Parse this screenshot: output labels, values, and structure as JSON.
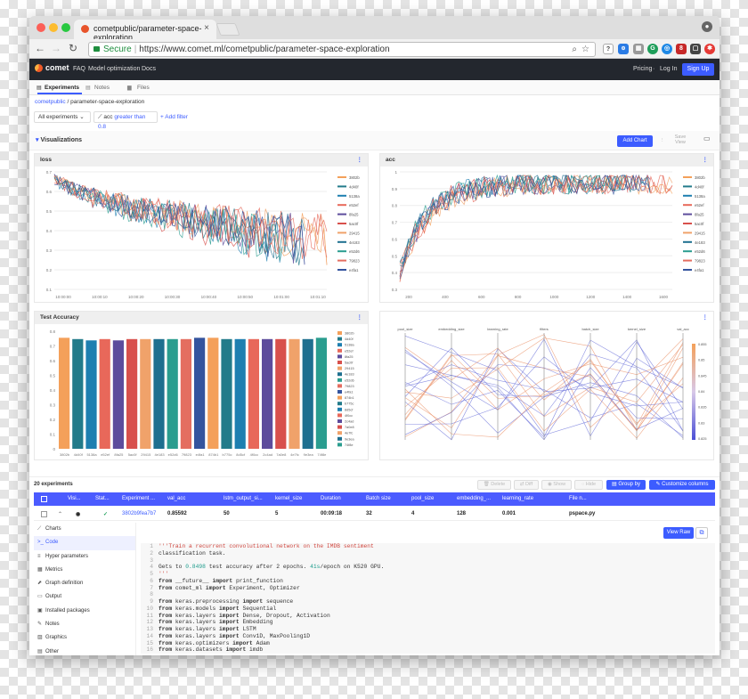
{
  "browser": {
    "tab_title": "cometpublic/parameter-space-exploration",
    "secure": "Secure",
    "url": "https://www.comet.ml/cometpublic/parameter-space-exploration"
  },
  "comet": {
    "brand": "comet",
    "nav": [
      "FAQ",
      "Model optimization",
      "Docs"
    ],
    "pricing": "Pricing",
    "login": "Log In",
    "signup": "Sign Up"
  },
  "page_tabs": [
    "Experiments",
    "Notes",
    "Files"
  ],
  "breadcrumb": {
    "workspace": "cometpublic",
    "sep": " / ",
    "project": "parameter-space-exploration"
  },
  "filters": {
    "all": "All experiments",
    "metric": "acc",
    "cond": "greater than 0.8",
    "add": "+ Add filter"
  },
  "viz": {
    "title": "Visualizations",
    "add_chart": "Add Chart",
    "save_view": "Save View"
  },
  "panels": {
    "loss": {
      "title": "loss",
      "legend": [
        "3802b",
        "4d40f",
        "5138a",
        "e52ef",
        "8fa25",
        "5ac0f",
        "29415",
        "4e183",
        "e52d6",
        "79823",
        "e4fa1"
      ],
      "x_ticks": [
        "10:00:00",
        "10:00:10",
        "10:00:20",
        "10:00:30",
        "10:00:40",
        "10:00:50",
        "10:01:00",
        "10:01:10"
      ],
      "y_ticks": [
        "0.7",
        "0.6",
        "0.5",
        "0.4",
        "0.3",
        "0.2",
        "0.1"
      ]
    },
    "acc": {
      "title": "acc",
      "legend": [
        "3802b",
        "4d40f",
        "5138a",
        "e52ef",
        "8fa25",
        "5ac0f",
        "29415",
        "4e183",
        "e52d6",
        "79823",
        "e4fa1"
      ],
      "x_ticks": [
        "200",
        "400",
        "600",
        "800",
        "1000",
        "1200",
        "1400",
        "1600"
      ],
      "y_ticks": [
        "1",
        "0.9",
        "0.8",
        "0.7",
        "0.6",
        "0.5",
        "0.4",
        "0.3"
      ]
    },
    "test_accuracy": {
      "title": "Test Accuracy",
      "y_ticks": [
        "0.8",
        "0.7",
        "0.6",
        "0.5",
        "0.4",
        "0.3",
        "0.2",
        "0.1",
        "0"
      ]
    },
    "parallel": {
      "axes": [
        "pool_size",
        "embedding_size",
        "learning_rate",
        "filters",
        "batch_size",
        "kernel_size",
        "val_acc"
      ],
      "color_scale": [
        "0.855",
        "0.85",
        "0.845",
        "0.84",
        "0.835",
        "0.83",
        "0.825"
      ]
    }
  },
  "chart_data": [
    {
      "type": "bar",
      "title": "Test Accuracy",
      "categories": [
        "3802b",
        "4d40f",
        "5138a",
        "e52ef",
        "8fa25",
        "5ac0f",
        "29415",
        "4e183",
        "e52d6",
        "79823",
        "e4fa1",
        "874b1",
        "b775c",
        "8d5cf",
        "4f0cc",
        "2c4ad",
        "7a0e8",
        "4e7fc",
        "9e3ea",
        "74f8e"
      ],
      "values": [
        0.85,
        0.84,
        0.83,
        0.84,
        0.83,
        0.84,
        0.84,
        0.84,
        0.84,
        0.84,
        0.85,
        0.85,
        0.84,
        0.84,
        0.84,
        0.84,
        0.84,
        0.84,
        0.84,
        0.85
      ],
      "ylim": [
        0,
        0.9
      ]
    }
  ],
  "experiments": {
    "count": "20 experiments",
    "actions": [
      "Delete",
      "Diff",
      "Show",
      "Hide"
    ],
    "group": "Group by",
    "customize": "Customize columns",
    "columns": [
      "Visi...",
      "Stat...",
      "Experiment ...",
      "val_acc",
      "lstm_output_si...",
      "kernel_size",
      "Duration",
      "Batch size",
      "pool_size",
      "embedding_...",
      "learning_rate",
      "File n..."
    ],
    "row": {
      "experiment": "3802b9fea7b7",
      "val_acc": "0.85592",
      "lstm": "50",
      "kernel": "5",
      "duration": "00:09:18",
      "batch": "32",
      "pool": "4",
      "embedding": "128",
      "lr": "0.001",
      "file": "pspace.py"
    }
  },
  "detail": {
    "sidebar": [
      "Charts",
      "Code",
      "Hyper parameters",
      "Metrics",
      "Graph definition",
      "Output",
      "Installed packages",
      "Notes",
      "Graphics",
      "Other"
    ],
    "view_raw": "View Raw",
    "code": [
      "'''Train a recurrent convolutional network on the IMDB sentiment",
      "classification task.",
      "",
      "Gets to 0.8498 test accuracy after 2 epochs. 41s/epoch on K520 GPU.",
      "'''",
      "from __future__ import print_function",
      "from comet_ml import Experiment, Optimizer",
      "",
      "from keras.preprocessing import sequence",
      "from keras.models import Sequential",
      "from keras.layers import Dense, Dropout, Activation",
      "from keras.layers import Embedding",
      "from keras.layers import LSTM",
      "from keras.layers import Conv1D, MaxPooling1D",
      "from keras.optimizers import Adam",
      "from keras.datasets import imdb"
    ]
  },
  "colors": {
    "accent": "#3c5cff",
    "palette": [
      "#f4a05a",
      "#227b8a",
      "#1e7fb0",
      "#e8685a",
      "#5d4c9c",
      "#d8504c",
      "#f0a26a",
      "#1e6f8f",
      "#2a9d8f",
      "#e46e60",
      "#34549e"
    ]
  }
}
